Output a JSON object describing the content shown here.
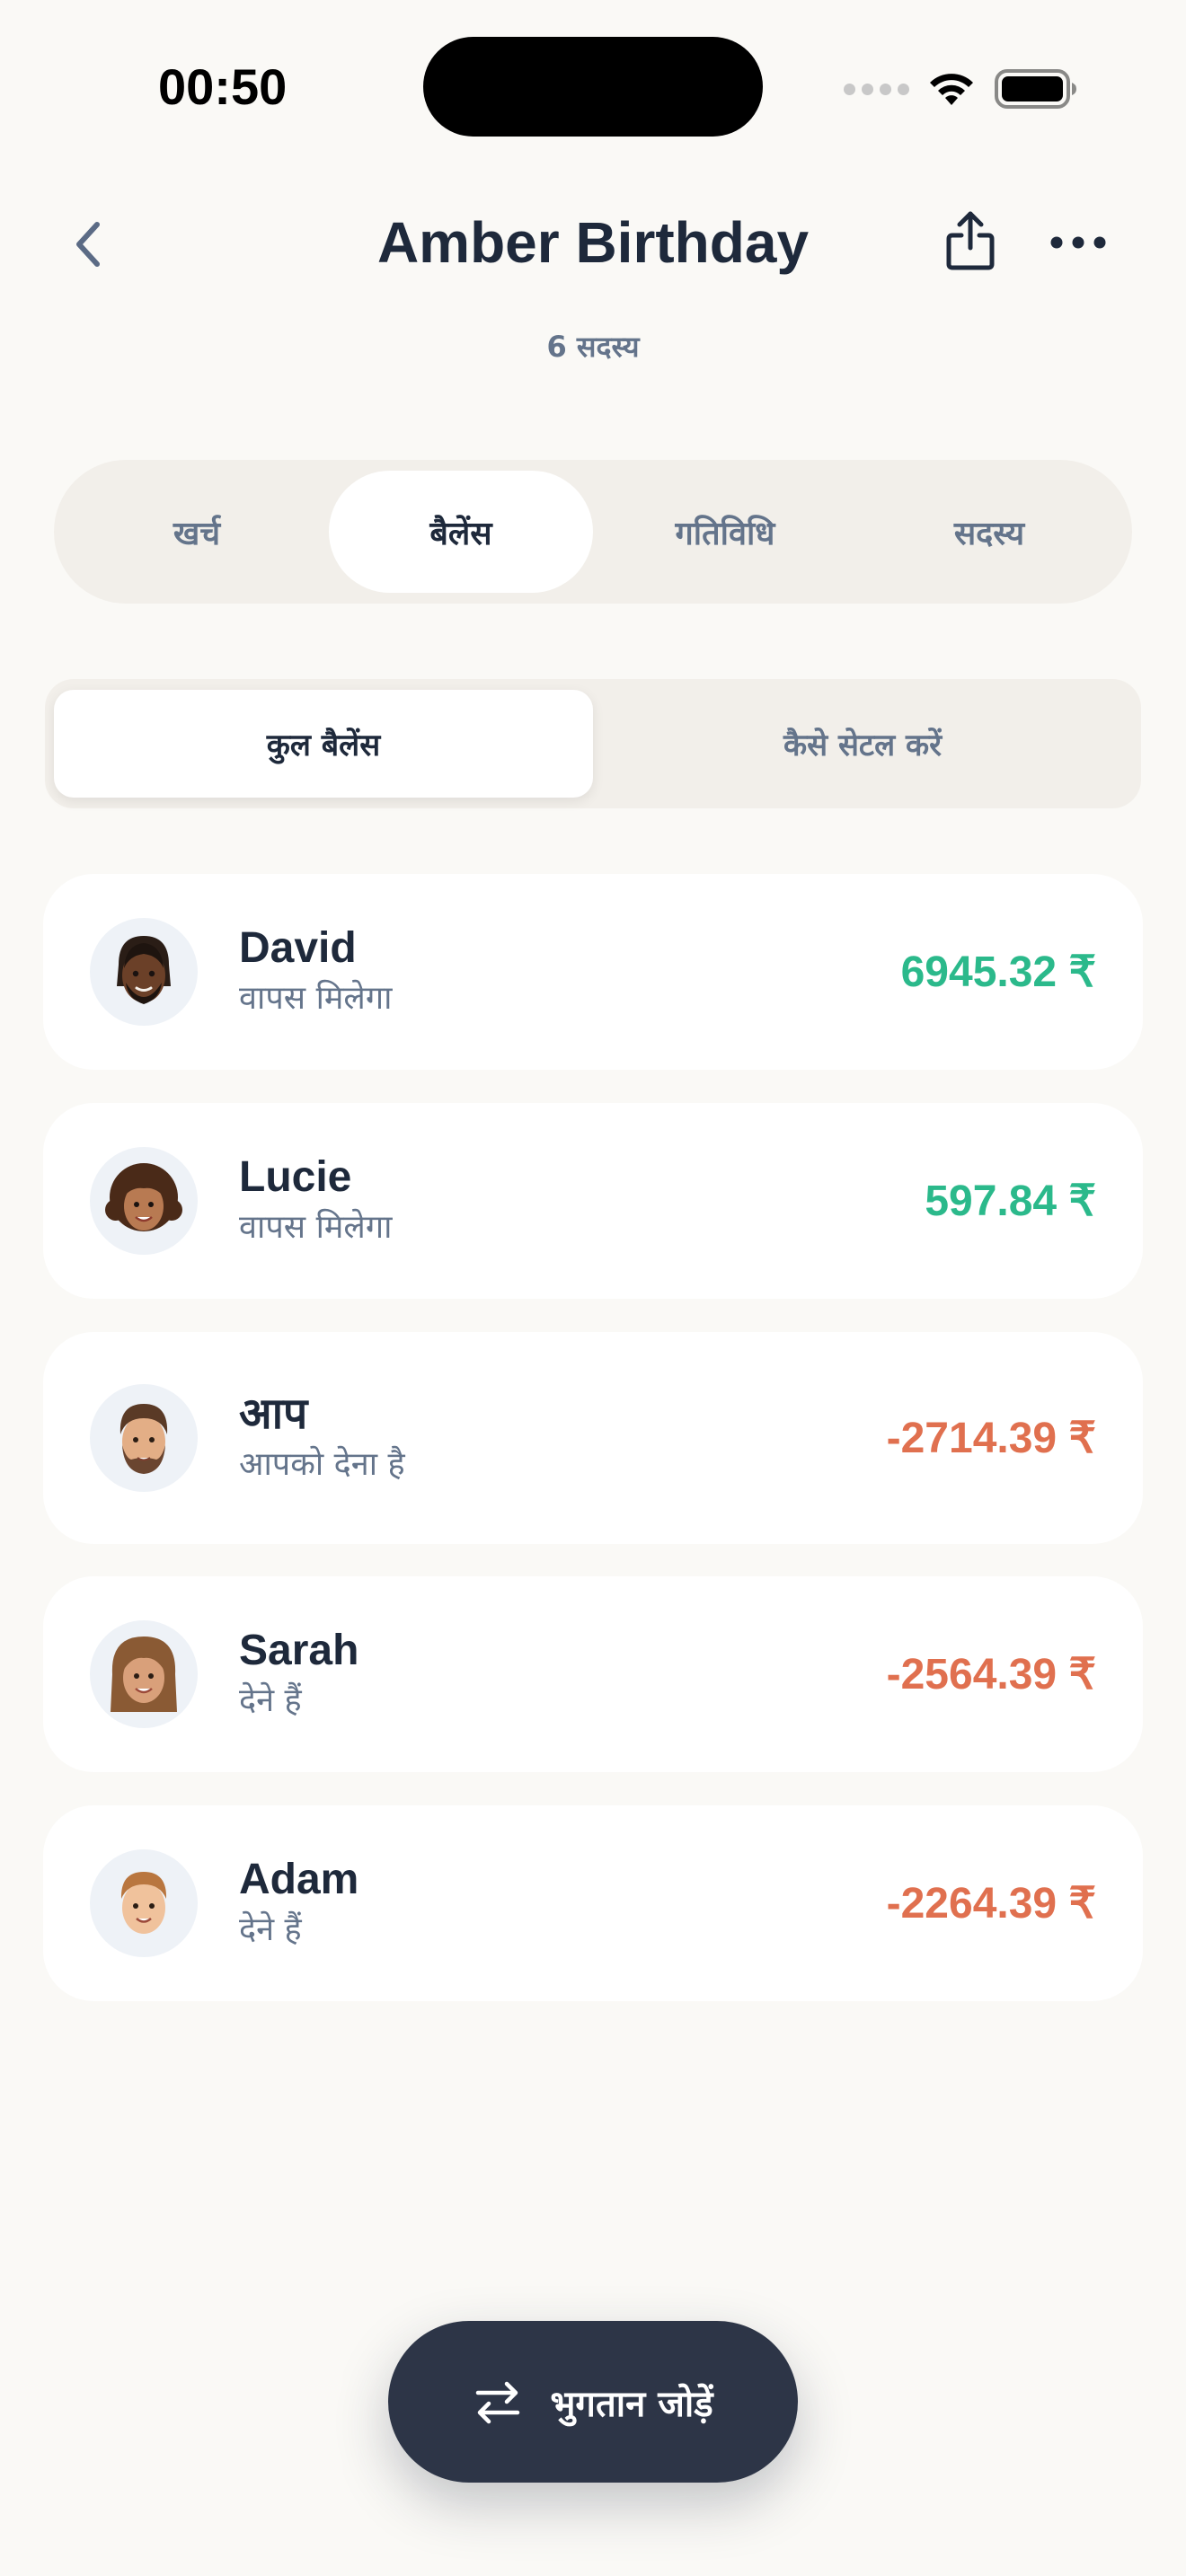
{
  "status_bar": {
    "time": "00:50"
  },
  "header": {
    "title": "Amber Birthday",
    "subtitle": "6 सदस्य"
  },
  "tabs": [
    {
      "label": "खर्च",
      "active": false
    },
    {
      "label": "बैलेंस",
      "active": true
    },
    {
      "label": "गतिविधि",
      "active": false
    },
    {
      "label": "सदस्य",
      "active": false
    }
  ],
  "segments": [
    {
      "label": "कुल बैलेंस",
      "active": true
    },
    {
      "label": "कैसे सेटल करें",
      "active": false
    }
  ],
  "balances": [
    {
      "name": "David",
      "note": "वापस मिलेगा",
      "amount": "6945.32 ₹",
      "direction": "positive",
      "avatar": "memoji-avatar-dreadlocks"
    },
    {
      "name": "Lucie",
      "note": "वापस मिलेगा",
      "amount": "597.84 ₹",
      "direction": "positive",
      "avatar": "memoji-avatar-curly-hair"
    },
    {
      "name": "आप",
      "note": "आपको देना है",
      "amount": "-2714.39 ₹",
      "direction": "negative",
      "avatar": "memoji-avatar-beard"
    },
    {
      "name": "Sarah",
      "note": "देने हैं",
      "amount": "-2564.39 ₹",
      "direction": "negative",
      "avatar": "memoji-avatar-long-wavy-hair"
    },
    {
      "name": "Adam",
      "note": "देने हैं",
      "amount": "-2264.39 ₹",
      "direction": "negative",
      "avatar": "memoji-avatar-short-hair"
    }
  ],
  "fab": {
    "label": "भुगतान जोड़ें",
    "icon": "arrows-exchange-icon"
  },
  "colors": {
    "background": "#FAF9F6",
    "positive": "#2BB98B",
    "negative": "#E0704F",
    "fab": "#2D3547"
  }
}
